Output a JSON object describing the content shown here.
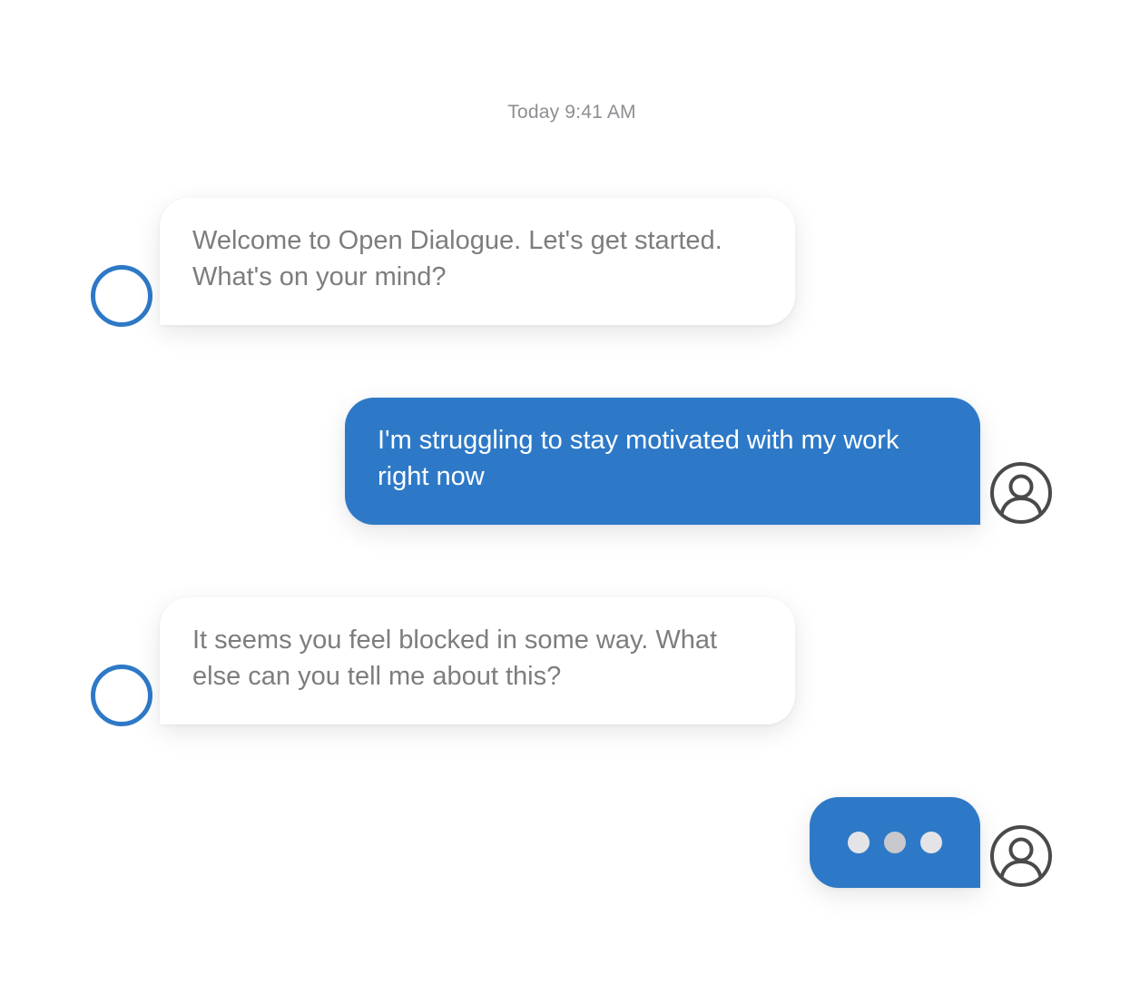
{
  "timestamp": "Today 9:41 AM",
  "colors": {
    "accent": "#2e79c7",
    "bot_text": "#7d7d7d",
    "timestamp": "#8e8e93",
    "user_text": "#ffffff"
  },
  "messages": [
    {
      "sender": "bot",
      "avatar_icon": "ring-avatar-icon",
      "text": "Welcome to Open Dialogue. Let's get started. What's on your mind?"
    },
    {
      "sender": "user",
      "avatar_icon": "user-profile-icon",
      "text": "I'm struggling to stay motivated with my work right now"
    },
    {
      "sender": "bot",
      "avatar_icon": "ring-avatar-icon",
      "text": "It seems you feel blocked in some way. What else can you tell me about this?"
    }
  ],
  "typing_indicator": {
    "sender": "user",
    "avatar_icon": "user-profile-icon",
    "icon": "typing-dots-icon"
  }
}
